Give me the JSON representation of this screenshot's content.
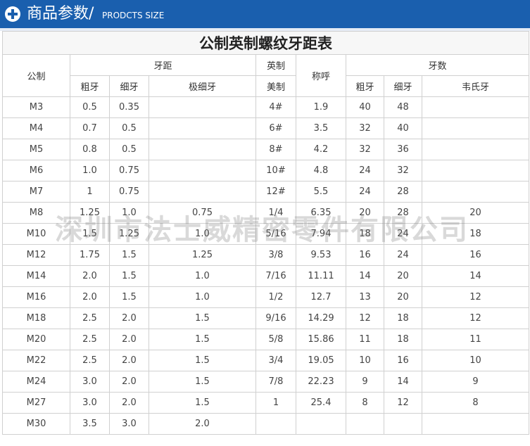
{
  "header": {
    "title_cn": "商品参数/",
    "title_en": "PRODCTS SIZE"
  },
  "table": {
    "title": "公制英制螺纹牙距表",
    "h_metric": "公制",
    "h_pitch": "牙距",
    "h_coarse": "粗牙",
    "h_fine": "细牙",
    "h_extra_fine": "极细牙",
    "h_imperial_1": "英制",
    "h_imperial_2": "美制",
    "h_nominal": "称呼",
    "h_tpi": "牙数",
    "h_tpi_coarse": "粗牙",
    "h_tpi_fine": "细牙",
    "h_whitworth": "韦氏牙",
    "rows": [
      {
        "metric": "M3",
        "coarse": "0.5",
        "fine": "0.35",
        "extra": "",
        "imperial": "4#",
        "nominal": "1.9",
        "tc": "40",
        "tf": "48",
        "ww": ""
      },
      {
        "metric": "M4",
        "coarse": "0.7",
        "fine": "0.5",
        "extra": "",
        "imperial": "6#",
        "nominal": "3.5",
        "tc": "32",
        "tf": "40",
        "ww": ""
      },
      {
        "metric": "M5",
        "coarse": "0.8",
        "fine": "0.5",
        "extra": "",
        "imperial": "8#",
        "nominal": "4.2",
        "tc": "32",
        "tf": "36",
        "ww": ""
      },
      {
        "metric": "M6",
        "coarse": "1.0",
        "fine": "0.75",
        "extra": "",
        "imperial": "10#",
        "nominal": "4.8",
        "tc": "24",
        "tf": "32",
        "ww": ""
      },
      {
        "metric": "M7",
        "coarse": "1",
        "fine": "0.75",
        "extra": "",
        "imperial": "12#",
        "nominal": "5.5",
        "tc": "24",
        "tf": "28",
        "ww": ""
      },
      {
        "metric": "M8",
        "coarse": "1.25",
        "fine": "1.0",
        "extra": "0.75",
        "imperial": "1/4",
        "nominal": "6.35",
        "tc": "20",
        "tf": "28",
        "ww": "20"
      },
      {
        "metric": "M10",
        "coarse": "1.5",
        "fine": "1.25",
        "extra": "1.0",
        "imperial": "5/16",
        "nominal": "7.94",
        "tc": "18",
        "tf": "24",
        "ww": "18"
      },
      {
        "metric": "M12",
        "coarse": "1.75",
        "fine": "1.5",
        "extra": "1.25",
        "imperial": "3/8",
        "nominal": "9.53",
        "tc": "16",
        "tf": "24",
        "ww": "16"
      },
      {
        "metric": "M14",
        "coarse": "2.0",
        "fine": "1.5",
        "extra": "1.0",
        "imperial": "7/16",
        "nominal": "11.11",
        "tc": "14",
        "tf": "20",
        "ww": "14"
      },
      {
        "metric": "M16",
        "coarse": "2.0",
        "fine": "1.5",
        "extra": "1.0",
        "imperial": "1/2",
        "nominal": "12.7",
        "tc": "13",
        "tf": "20",
        "ww": "12"
      },
      {
        "metric": "M18",
        "coarse": "2.5",
        "fine": "2.0",
        "extra": "1.5",
        "imperial": "9/16",
        "nominal": "14.29",
        "tc": "12",
        "tf": "18",
        "ww": "12"
      },
      {
        "metric": "M20",
        "coarse": "2.5",
        "fine": "2.0",
        "extra": "1.5",
        "imperial": "5/8",
        "nominal": "15.86",
        "tc": "11",
        "tf": "18",
        "ww": "11"
      },
      {
        "metric": "M22",
        "coarse": "2.5",
        "fine": "2.0",
        "extra": "1.5",
        "imperial": "3/4",
        "nominal": "19.05",
        "tc": "10",
        "tf": "16",
        "ww": "10"
      },
      {
        "metric": "M24",
        "coarse": "3.0",
        "fine": "2.0",
        "extra": "1.5",
        "imperial": "7/8",
        "nominal": "22.23",
        "tc": "9",
        "tf": "14",
        "ww": "9"
      },
      {
        "metric": "M27",
        "coarse": "3.0",
        "fine": "2.0",
        "extra": "1.5",
        "imperial": "1",
        "nominal": "25.4",
        "tc": "8",
        "tf": "12",
        "ww": "8"
      },
      {
        "metric": "M30",
        "coarse": "3.5",
        "fine": "3.0",
        "extra": "2.0",
        "imperial": "",
        "nominal": "",
        "tc": "",
        "tf": "",
        "ww": ""
      }
    ]
  },
  "watermark": "深圳市法士威精密零件有限公司",
  "colors": {
    "header_bg": "#1a5fae",
    "border": "#d0d0d0"
  }
}
